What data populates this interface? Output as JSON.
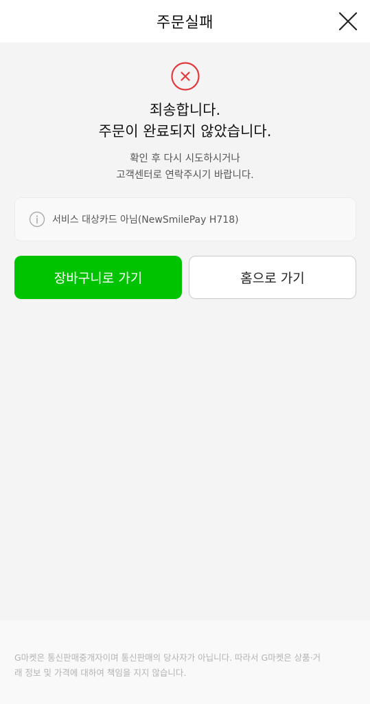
{
  "header": {
    "title": "주문실패"
  },
  "main": {
    "title_line1": "죄송합니다.",
    "title_line2": "주문이 완료되지 않았습니다.",
    "desc_line1": "확인 후 다시 시도하시거나",
    "desc_line2": "고객센터로 연락주시기 바랍니다.",
    "notice": "서비스 대상카드 아님(NewSmilePay H718)"
  },
  "buttons": {
    "cart_label": "장바구니로 가기",
    "home_label": "홈으로 가기"
  },
  "footer": {
    "line1": "G마켓은 통신판매중개자이며 통신판매의 당사자가 아닙니다. 따라서 G마켓은 상품·거",
    "line2": "래 정보 및 가격에 대하여 책임을 지지 않습니다."
  },
  "colors": {
    "accent_green": "#00c300",
    "error_red": "#e0393e"
  },
  "icons": {
    "close": "close-icon",
    "error": "error-x-circle-icon",
    "info": "info-icon"
  }
}
